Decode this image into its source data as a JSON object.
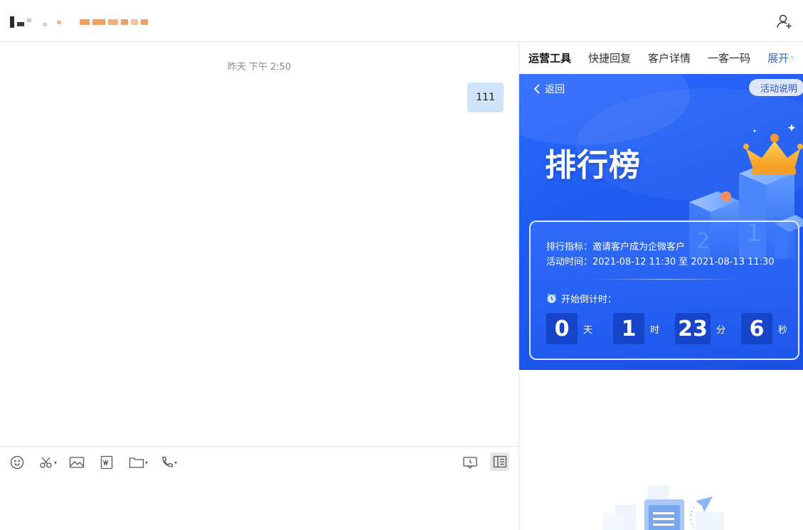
{
  "header": {
    "name_redacted_colors": [
      "#2a2a2a",
      "#c9c9c9",
      "#f0a060"
    ]
  },
  "chat": {
    "timestamp": "昨天 下午 2:50",
    "messages": [
      {
        "text": "111",
        "from": "self"
      }
    ]
  },
  "toolbar": {
    "icons": [
      "emoji-icon",
      "scissors-icon",
      "image-icon",
      "word-doc-icon",
      "folder-icon",
      "phone-icon",
      "chat-summary-icon",
      "side-panel-icon"
    ]
  },
  "panel": {
    "tabs": [
      {
        "label": "运营工具",
        "active": true
      },
      {
        "label": "快捷回复",
        "active": false
      },
      {
        "label": "客户详情",
        "active": false
      },
      {
        "label": "一客一码",
        "active": false
      }
    ],
    "expand_label": "展开",
    "back_label": "返回",
    "explain_label": "活动说明",
    "title": "排行榜",
    "metric_line": "排行指标：邀请客户成为企微客户",
    "time_line": "活动时间：2021-08-12 11:30 至 2021-08-13 11:30",
    "countdown_label": "开始倒计时：",
    "countdown": [
      {
        "value": "0",
        "unit": "天"
      },
      {
        "value": "1",
        "unit": "时"
      },
      {
        "value": "23",
        "unit": "分"
      },
      {
        "value": "6",
        "unit": "秒"
      }
    ]
  },
  "colors": {
    "accent": "#2b6ef5",
    "banner": "#1f5cf2",
    "bubble": "#cfe3fb"
  }
}
